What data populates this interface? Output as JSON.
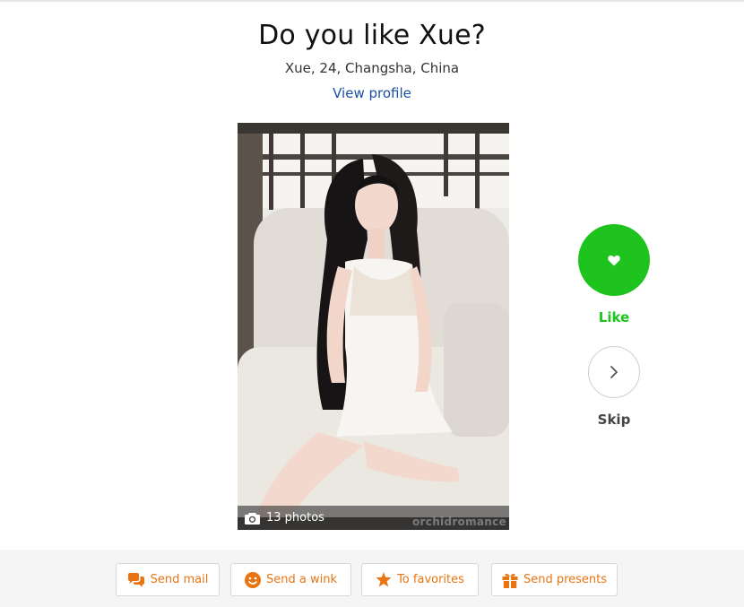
{
  "header": {
    "title": "Do you like Xue?",
    "subtitle": "Xue, 24, Changsha, China",
    "view_profile_label": "View profile"
  },
  "photo": {
    "count_label": "13 photos",
    "watermark": "orchidromance"
  },
  "actions_side": {
    "like_label": "Like",
    "skip_label": "Skip"
  },
  "bottom_actions": [
    {
      "label": "Send mail",
      "icon": "chat-bubbles-icon"
    },
    {
      "label": "Send a wink",
      "icon": "smiley-icon"
    },
    {
      "label": "To favorites",
      "icon": "star-icon"
    },
    {
      "label": "Send presents",
      "icon": "gift-icon"
    }
  ],
  "colors": {
    "accent_orange": "#e87512",
    "like_green": "#1ec31e",
    "link_blue": "#1b4fa3"
  }
}
